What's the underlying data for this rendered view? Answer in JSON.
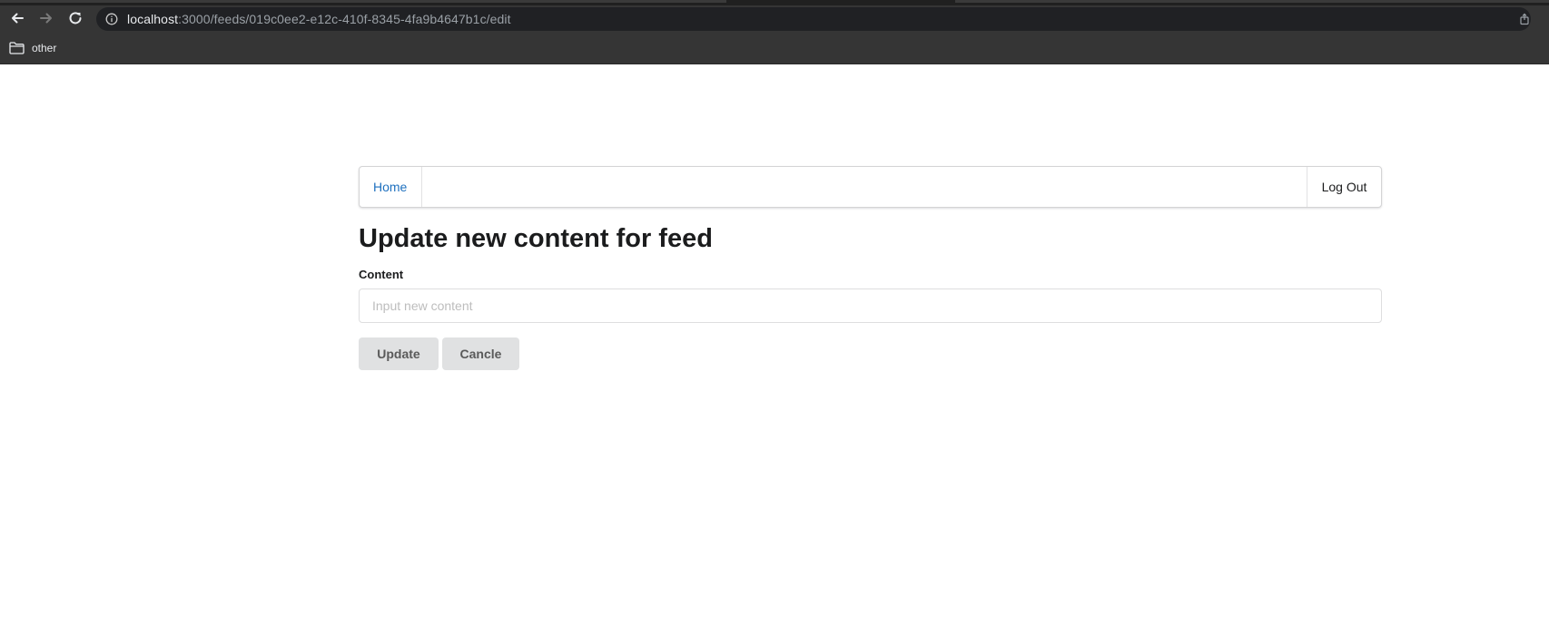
{
  "browser": {
    "url_host": "localhost",
    "url_path": ":3000/feeds/019c0ee2-e12c-410f-8345-4fa9b4647b1c/edit",
    "back_icon": "arrow-left-icon",
    "forward_icon": "arrow-right-icon",
    "reload_icon": "reload-icon",
    "info_icon": "info-icon",
    "share_icon": "share-icon",
    "bookmarks": [
      {
        "label": "other",
        "icon": "folder-icon"
      }
    ]
  },
  "nav": {
    "home_label": "Home",
    "logout_label": "Log Out"
  },
  "form": {
    "title": "Update new content for feed",
    "content_label": "Content",
    "content_placeholder": "Input new content",
    "content_value": "",
    "update_label": "Update",
    "cancel_label": "Cancle"
  },
  "colors": {
    "link": "#1e70bf",
    "button_bg": "#e0e1e2",
    "chrome_bg": "#353535",
    "address_bg": "#202124"
  }
}
